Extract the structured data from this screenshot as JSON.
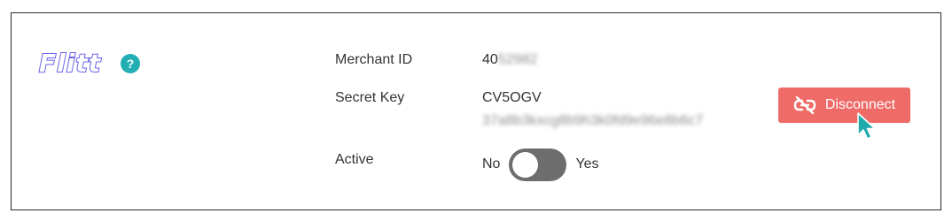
{
  "brand": {
    "logo_text": "Flitt",
    "help_glyph": "?",
    "accent": "#6a63e8",
    "help_color": "#23aeb4"
  },
  "fields": {
    "merchant_id": {
      "label": "Merchant ID",
      "value_visible": "40",
      "value_masked": "52982"
    },
    "secret_key": {
      "label": "Secret Key",
      "value_visible": "CV5OGV",
      "value_masked": "37a8b3kxcg8b9h3k0fd9e96e8b6c7"
    },
    "active": {
      "label": "Active",
      "off_label": "No",
      "on_label": "Yes",
      "state": false
    }
  },
  "actions": {
    "disconnect_label": "Disconnect",
    "disconnect_color": "#ef6b68",
    "disconnect_icon": "unlink-icon"
  }
}
